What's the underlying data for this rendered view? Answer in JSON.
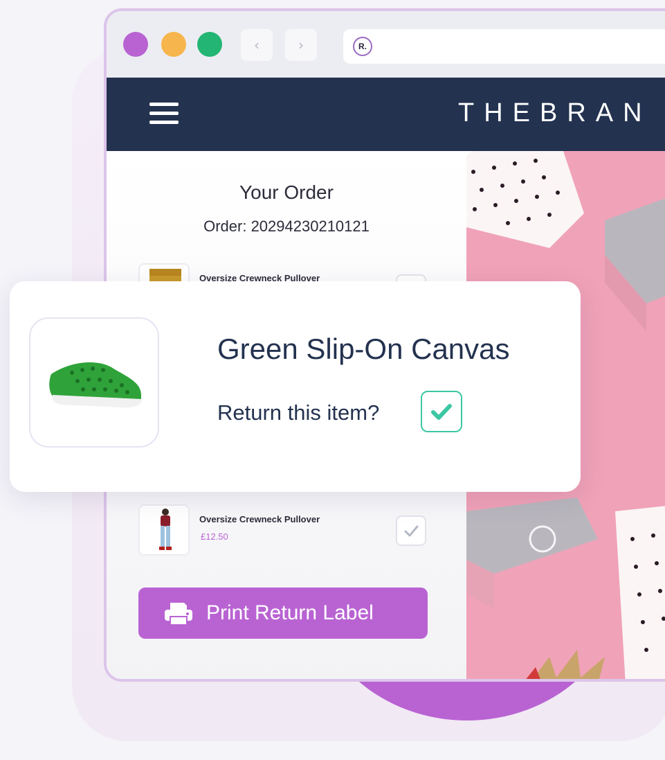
{
  "browser": {
    "back_icon": "‹",
    "forward_icon": "›",
    "favicon_text": "R."
  },
  "header": {
    "menu_icon": "hamburger-icon",
    "brand": "THEBRAN"
  },
  "order": {
    "title": "Your Order",
    "number_label": "Order: 20294230210121",
    "items": [
      {
        "name": "Oversize Crewneck Pullover",
        "price": "",
        "thumbnail": "mustard-sweater",
        "checked": false
      },
      {
        "name": "Oversize Crewneck Pullover",
        "price": "£12.50",
        "thumbnail": "jeans-outfit",
        "checked": true
      }
    ],
    "print_button": "Print Return Label"
  },
  "return_card": {
    "product_name": "Green Slip-On Canvas",
    "question": "Return this item?",
    "checked": true,
    "thumbnail": "green-shoe"
  },
  "colors": {
    "accent": "#b963d3",
    "navy": "#23324f",
    "check_green": "#3cc7a3"
  }
}
